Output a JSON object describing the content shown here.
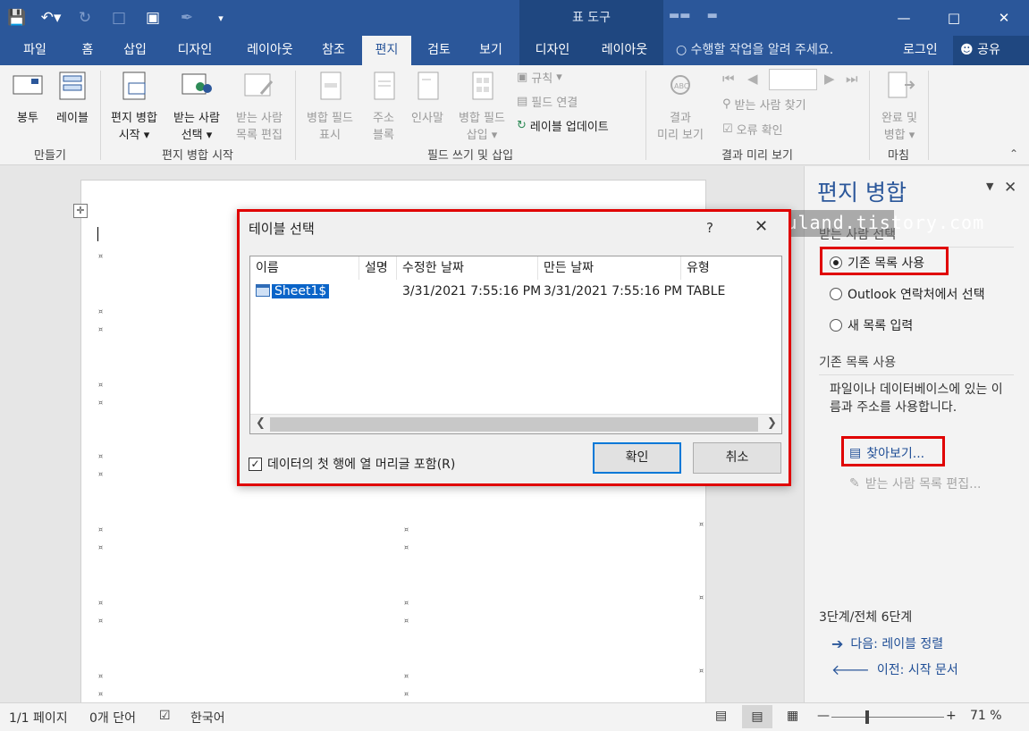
{
  "title_bar": {
    "contextual_title": "표 도구"
  },
  "tabs": {
    "file": "파일",
    "home": "홈",
    "insert": "삽입",
    "design": "디자인",
    "layout": "레이아웃",
    "references": "참조",
    "mailings": "편지",
    "review": "검토",
    "view": "보기",
    "table_design": "디자인",
    "table_layout": "레이아웃",
    "tell_me": "수행할 작업을 알려 주세요.",
    "login": "로그인",
    "share": "공유"
  },
  "ribbon": {
    "envelopes": "봉투",
    "labels": "레이블",
    "start_merge": "편지 병합",
    "start_merge_2": "시작",
    "select_recipients": "받는 사람",
    "select_recipients_2": "선택",
    "edit_recipients": "받는 사람",
    "edit_recipients_2": "목록 편집",
    "highlight_fields": "병합 필드",
    "highlight_fields_2": "표시",
    "address_block": "주소",
    "address_block_2": "블록",
    "greeting_line": "인사말",
    "insert_merge_field": "병합 필드",
    "insert_merge_field_2": "삽입",
    "rules": "규칙",
    "match_fields": "필드 연결",
    "update_labels": "레이블 업데이트",
    "preview_results": "결과",
    "preview_results_2": "미리 보기",
    "find_recipient": "받는 사람 찾기",
    "check_errors": "오류 확인",
    "finish_merge": "완료 및",
    "finish_merge_2": "병합",
    "group_create": "만들기",
    "group_start": "편지 병합 시작",
    "group_write": "필드 쓰기 및 삽입",
    "group_preview": "결과 미리 보기",
    "group_finish": "마침"
  },
  "dialog": {
    "title": "테이블 선택",
    "help": "?",
    "columns": [
      "이름",
      "설명",
      "수정한 날짜",
      "만든 날짜",
      "유형"
    ],
    "rows": [
      {
        "name": "Sheet1$",
        "description": "",
        "modified": "3/31/2021 7:55:16 PM",
        "created": "3/31/2021 7:55:16 PM",
        "type": "TABLE"
      }
    ],
    "header_checkbox_label": "데이터의 첫 행에 열 머리글 포함(R)",
    "header_checkbox_checked": true,
    "ok": "확인",
    "cancel": "취소"
  },
  "pane": {
    "title": "편지 병합",
    "watermark": "http://jujuland.tistory.com",
    "section_select": "받는 사람 선택",
    "options": [
      {
        "label": "기존 목록 사용",
        "selected": true
      },
      {
        "label": "Outlook 연락처에서 선택",
        "selected": false
      },
      {
        "label": "새 목록 입력",
        "selected": false
      }
    ],
    "section_existing": "기존 목록 사용",
    "description": "파일이나 데이터베이스에 있는 이름과 주소를 사용합니다.",
    "browse": "찾아보기...",
    "edit_list": "받는 사람 목록 편집...",
    "step": "3단계/전체 6단계",
    "next": "다음: 레이블 정렬",
    "prev": "이전: 시작 문서"
  },
  "status": {
    "page": "1/1 페이지",
    "words": "0개 단어",
    "language": "한국어",
    "zoom": "71 %"
  },
  "colors": {
    "word_blue": "#2b579a",
    "highlight_red": "#e00000",
    "selection_blue": "#0a64c8"
  }
}
